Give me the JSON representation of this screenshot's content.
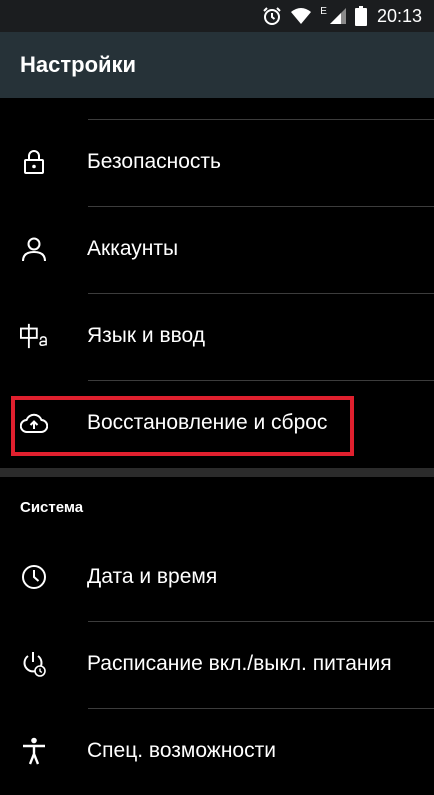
{
  "status_bar": {
    "time": "20:13",
    "network_label": "E",
    "icons": [
      "alarm-icon",
      "wifi-icon",
      "signal-icon",
      "battery-icon"
    ]
  },
  "app_bar": {
    "title": "Настройки"
  },
  "personal_items": [
    {
      "label": "Безопасность",
      "icon": "lock-icon"
    },
    {
      "label": "Аккаунты",
      "icon": "account-icon"
    },
    {
      "label": "Язык и ввод",
      "icon": "language-icon"
    },
    {
      "label": "Восстановление и сброс",
      "icon": "cloud-backup-icon"
    }
  ],
  "system_section": {
    "title": "Система",
    "items": [
      {
        "label": "Дата и время",
        "icon": "clock-icon"
      },
      {
        "label": "Расписание вкл./выкл. питания",
        "icon": "power-schedule-icon"
      },
      {
        "label": "Спец. возможности",
        "icon": "accessibility-icon"
      }
    ]
  },
  "colors": {
    "highlight": "#e0202e",
    "app_bar": "#263238",
    "status_bar": "#1b1d1f",
    "background": "#000000"
  }
}
